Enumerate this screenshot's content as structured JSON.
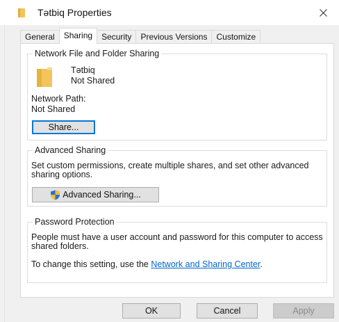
{
  "window": {
    "title": "Tətbiq Properties"
  },
  "tabs": [
    {
      "label": "General"
    },
    {
      "label": "Sharing"
    },
    {
      "label": "Security"
    },
    {
      "label": "Previous Versions"
    },
    {
      "label": "Customize"
    }
  ],
  "active_tab": "Sharing",
  "network_sharing": {
    "group_title": "Network File and Folder Sharing",
    "folder_name": "Tətbiq",
    "folder_status": "Not Shared",
    "network_path_label": "Network Path:",
    "network_path_value": "Not Shared",
    "share_button": "Share..."
  },
  "advanced_sharing": {
    "group_title": "Advanced Sharing",
    "description": "Set custom permissions, create multiple shares, and set other advanced sharing options.",
    "button": "Advanced Sharing..."
  },
  "password_protection": {
    "group_title": "Password Protection",
    "description": "People must have a user account and password for this computer to access shared folders.",
    "change_text": "To change this setting, use the ",
    "link": "Network and Sharing Center",
    "change_suffix": "."
  },
  "footer": {
    "ok": "OK",
    "cancel": "Cancel",
    "apply": "Apply"
  },
  "colors": {
    "accent": "#0078d7",
    "folder": "#f3c45a",
    "link": "#0066cc"
  },
  "icons": {
    "title": "folder-icon",
    "close": "close-icon",
    "folder": "folder-icon",
    "uac": "shield-icon"
  }
}
